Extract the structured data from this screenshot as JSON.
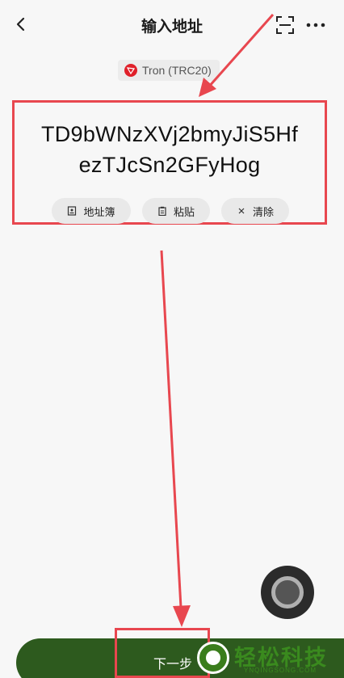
{
  "header": {
    "title": "输入地址",
    "back_icon": "chevron-left-icon",
    "scan_icon": "scan-icon",
    "more_icon": "more-horizontal-icon"
  },
  "network": {
    "label": "Tron (TRC20)",
    "logo_icon": "tron-logo-icon",
    "logo_color": "#e0202a"
  },
  "address": {
    "line1": "TD9bWNzXVj2bmyJiS5Hf",
    "line2": "ezTJcSn2GFyHog",
    "highlight_color": "#e8474f"
  },
  "actions": {
    "address_book": "地址簿",
    "paste": "粘贴",
    "clear": "清除"
  },
  "footer": {
    "next_label": "下一步",
    "button_color": "#2d5a1e"
  },
  "watermark": {
    "brand": "轻松科技",
    "domain": "YNQINGSONG.COM"
  }
}
